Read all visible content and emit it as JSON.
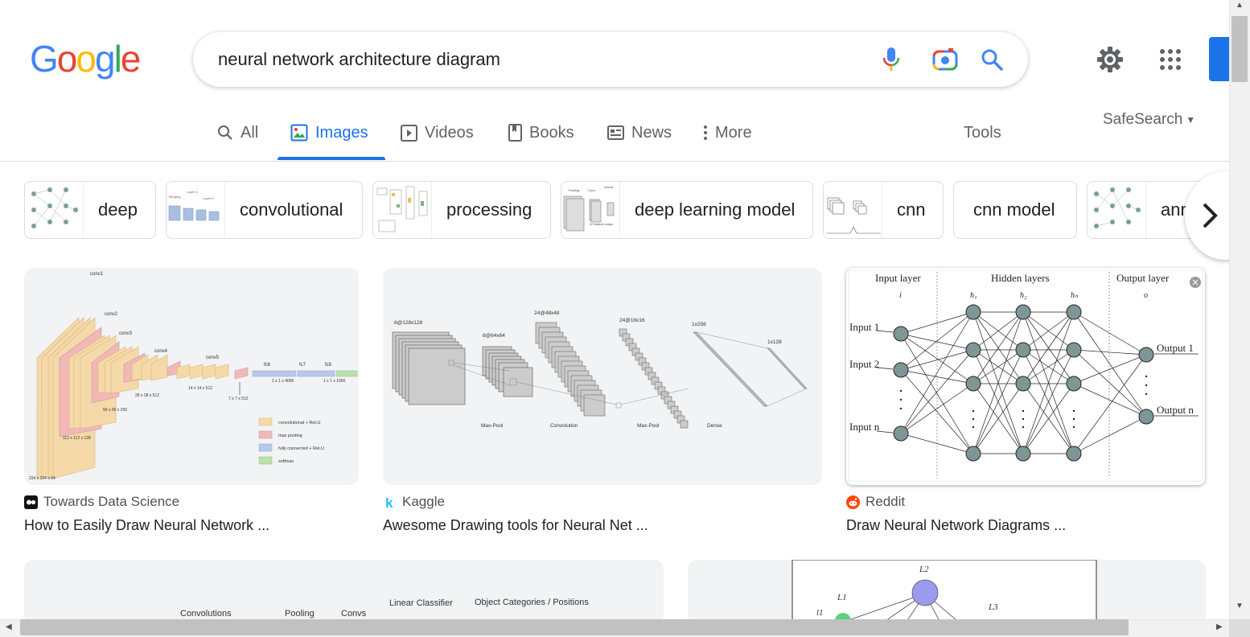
{
  "logo": {
    "letters": [
      "G",
      "o",
      "o",
      "g",
      "l",
      "e"
    ]
  },
  "search": {
    "query": "neural network architecture diagram"
  },
  "tabs": [
    {
      "label": "All"
    },
    {
      "label": "Images"
    },
    {
      "label": "Videos"
    },
    {
      "label": "Books"
    },
    {
      "label": "News"
    },
    {
      "label": "More"
    }
  ],
  "tools_label": "Tools",
  "safesearch_label": "SafeSearch",
  "chips": [
    "deep",
    "convolutional",
    "processing",
    "deep learning model",
    "cnn",
    "cnn model",
    "ann"
  ],
  "results": [
    {
      "source": "Towards Data Science",
      "title": "How to Easily Draw Neural Network ..."
    },
    {
      "source": "Kaggle",
      "title": "Awesome Drawing tools for Neural Net ..."
    },
    {
      "source": "Reddit",
      "title": "Draw Neural Network Diagrams ..."
    }
  ],
  "alexnet": {
    "layers": [
      "conv1",
      "conv2",
      "conv3",
      "conv4",
      "conv5",
      "fc6",
      "fc7",
      "fc8"
    ],
    "dims": [
      "224 x 224 x 64",
      "112 x 112 x 128",
      "56 x 56 x 256",
      "28 x 28 x 512",
      "14 x 14 x 512",
      "7 x 7 x 512",
      "1 x 1 x 4096",
      "1 x 1 x 1000"
    ],
    "legend": [
      "convolutional + ReLU",
      "max pooling",
      "fully connected + ReLU",
      "softmax"
    ]
  },
  "kaggle": {
    "dims": [
      "8@128x128",
      "8@64x64",
      "24@48x48",
      "24@16x16",
      "1x256",
      "1x128"
    ],
    "ops": [
      "Max-Pool",
      "Convolution",
      "Max-Pool",
      "Dense"
    ]
  },
  "reddit": {
    "headers": [
      "Input layer",
      "Hidden layers",
      "Output layer"
    ],
    "inputs": [
      "Input 1",
      "Input 2",
      "Input n"
    ],
    "outputs": [
      "Output 1",
      "Output n"
    ]
  },
  "bottom_left": {
    "labels": [
      "Convolutions",
      "Pooling",
      "Convs",
      "Linear Classifier",
      "Object Categories / Positions"
    ]
  },
  "bottom_right": {
    "labels": [
      "L2",
      "L1",
      "L3",
      "l1"
    ]
  },
  "colors": {
    "accent": "#1a73e8",
    "conv": "#f5d9a8",
    "pool": "#f2b8b8",
    "fc": "#b8c8ec",
    "softmax": "#b9e0ad"
  }
}
